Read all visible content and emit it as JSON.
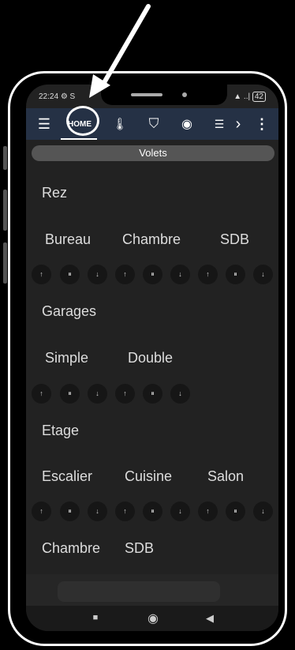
{
  "status_bar": {
    "time": "22:24",
    "time_suffix": "⚙ S",
    "signal": "▲ ..|",
    "battery": "42"
  },
  "toolbar": {
    "menu_icon": "☰",
    "home_label": "HOME",
    "thermometer_icon": "🌡",
    "shield_icon": "⛉",
    "camera_icon": "◉",
    "list_icon": "☰",
    "more_tabs": "›",
    "overflow": "⋮"
  },
  "section": {
    "title": "Volets"
  },
  "groups": [
    {
      "title": "Rez",
      "rooms": [
        "Bureau",
        "Chambre",
        "SDB"
      ]
    },
    {
      "title": "Garages",
      "rooms": [
        "Simple",
        "Double"
      ]
    },
    {
      "title": "Etage",
      "rooms": [
        "Escalier",
        "Cuisine",
        "Salon"
      ]
    },
    {
      "title": "",
      "rooms": [
        "Chambre",
        "SDB"
      ]
    }
  ],
  "controls": {
    "up": "↑",
    "pause": "⏸",
    "down": "↓"
  },
  "navbar": {
    "square": "■",
    "circle": "◉",
    "back": "◀"
  }
}
